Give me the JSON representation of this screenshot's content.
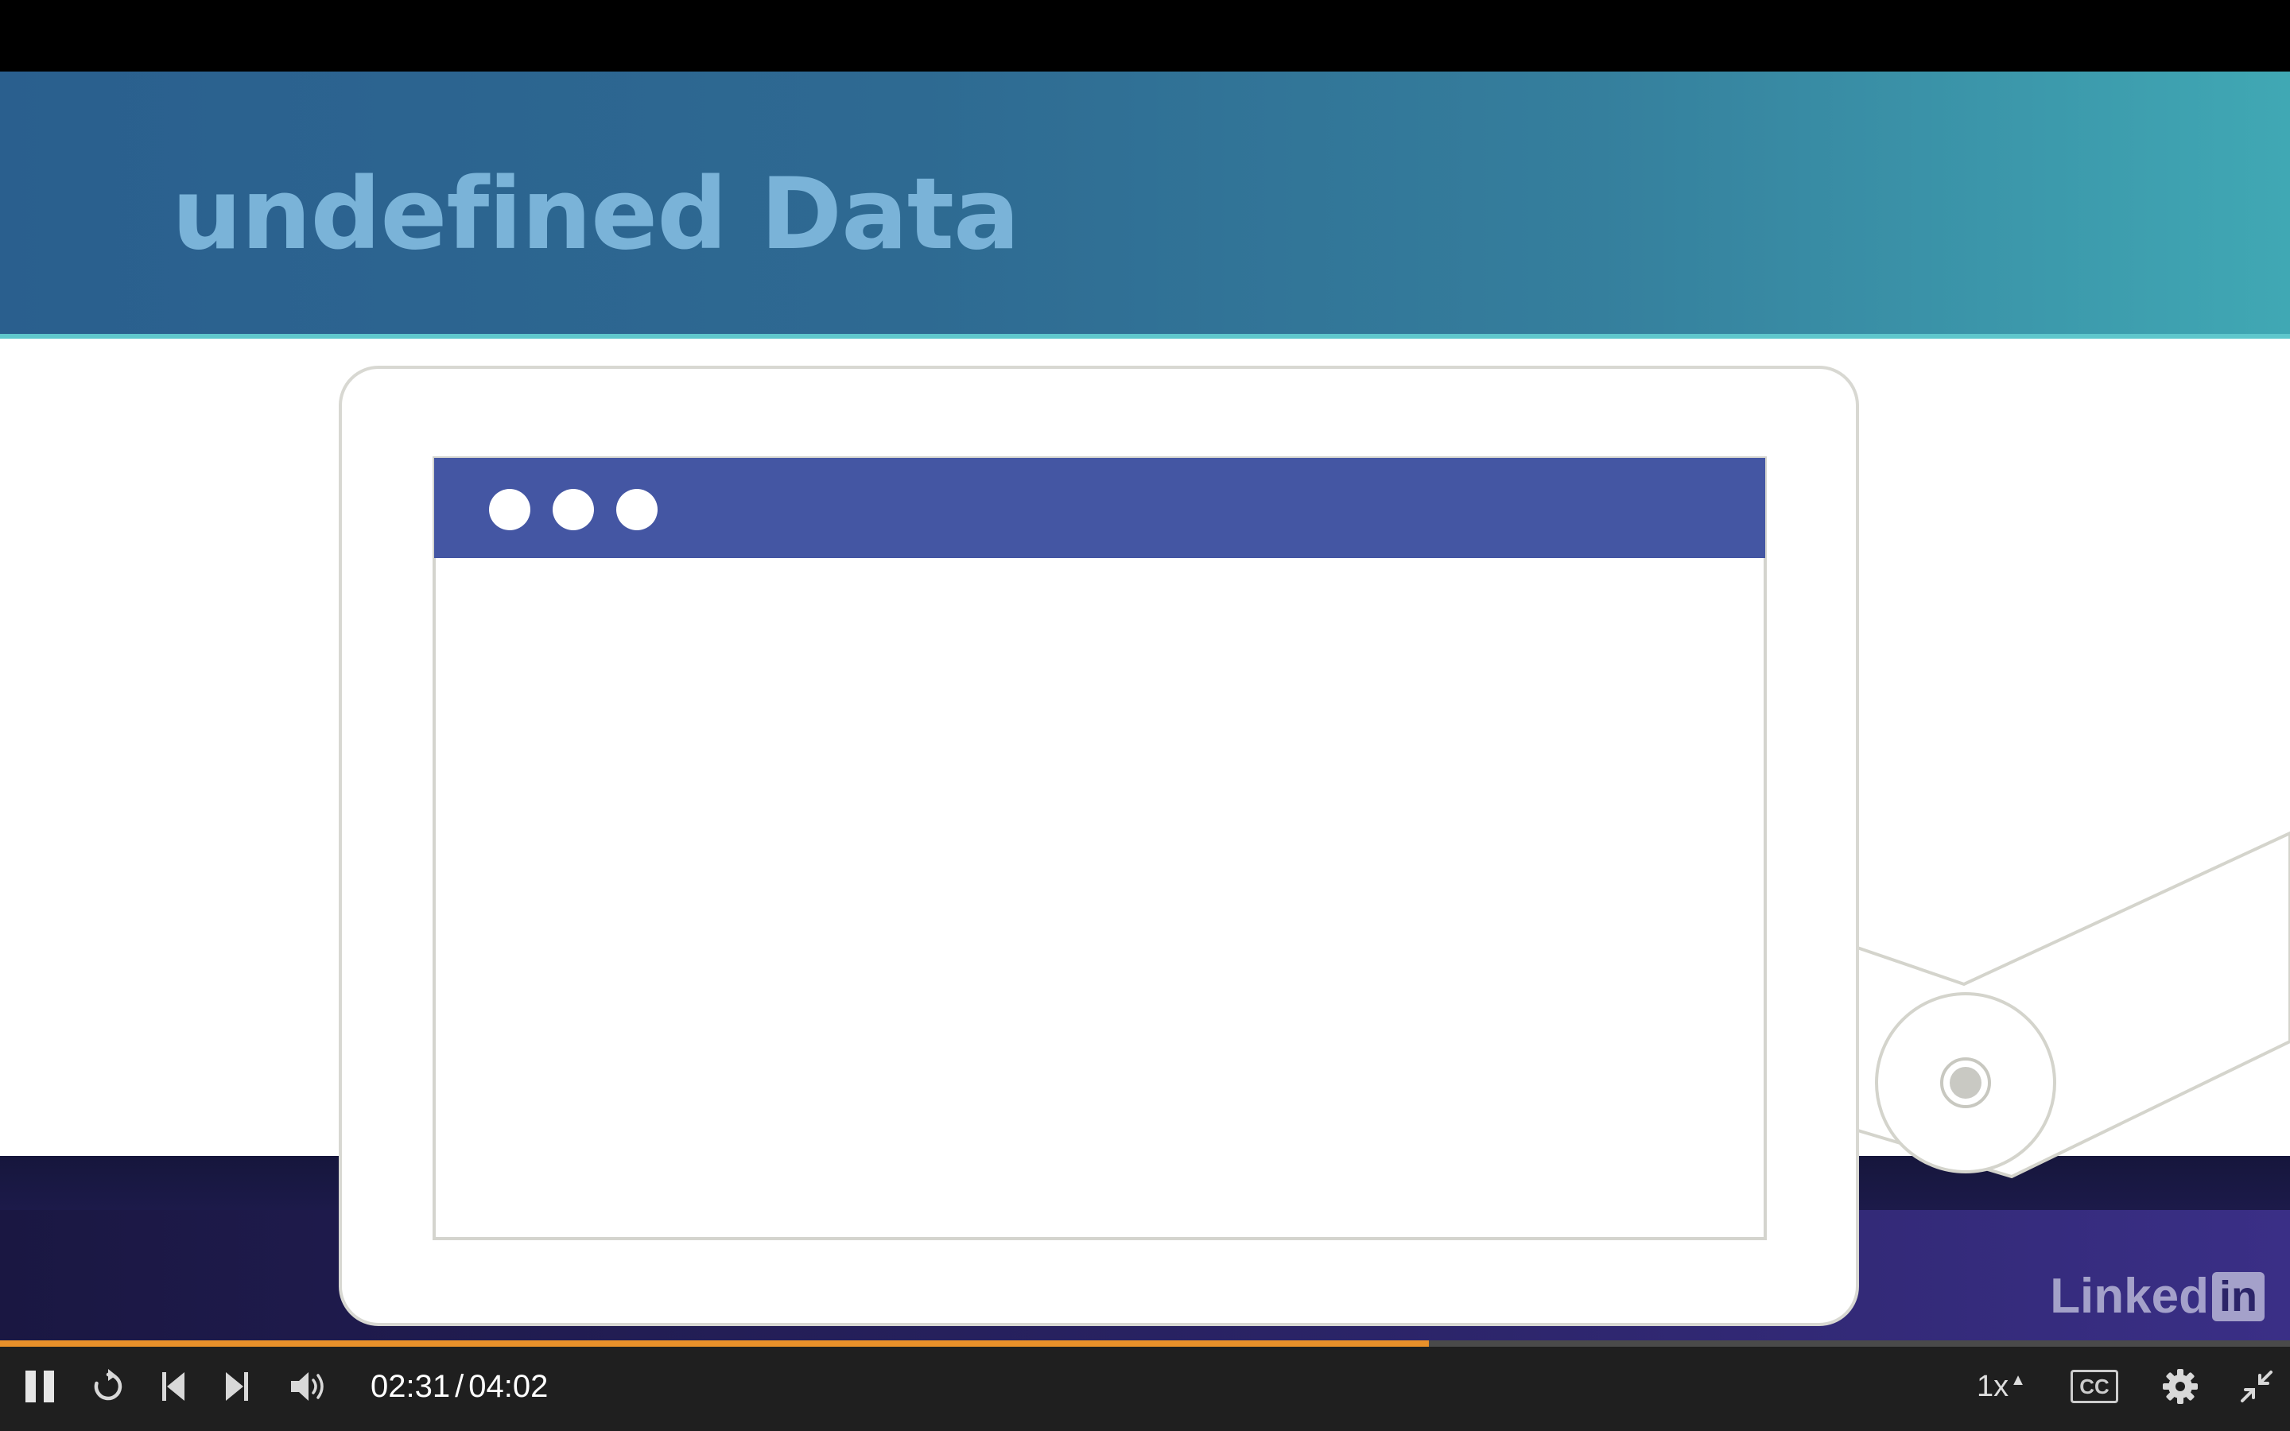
{
  "slide": {
    "title": "undefined Data",
    "brand": {
      "text": "Linked",
      "badge": "in"
    },
    "colors": {
      "header_start": "#2a5f8e",
      "header_end": "#40a8b4",
      "title": "#7ab3d8",
      "window_bar": "#4456a3",
      "footer": "#2a2366",
      "outline": "#d8d8d2"
    }
  },
  "player": {
    "current_time": "02:31",
    "separator": "/",
    "duration": "04:02",
    "progress_fraction": 0.624,
    "speed": "1x",
    "cc_label": "CC",
    "accent_color": "#e8902a",
    "icons": {
      "play_pause": "pause-icon",
      "replay": "replay-icon",
      "previous": "skip-previous-icon",
      "next": "skip-next-icon",
      "volume": "volume-icon",
      "settings": "gear-icon",
      "fullscreen": "exit-fullscreen-icon"
    }
  }
}
